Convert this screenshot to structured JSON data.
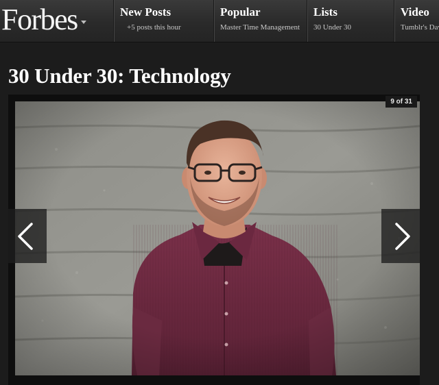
{
  "brand": {
    "logo_text": "Forbes",
    "logo_icon": "chevron-down-icon"
  },
  "nav": [
    {
      "title": "New Posts",
      "subtitle": "+5 posts this hour"
    },
    {
      "title": "Popular",
      "subtitle": "Master Time Management"
    },
    {
      "title": "Lists",
      "subtitle": "30 Under 30"
    },
    {
      "title": "Video",
      "subtitle": "Tumblr's David Karp"
    }
  ],
  "page": {
    "title": "30 Under 30: Technology"
  },
  "slideshow": {
    "counter": "9 of 31",
    "prev_icon": "chevron-left-icon",
    "next_icon": "chevron-right-icon",
    "photo": "portrait-photo"
  },
  "colors": {
    "background": "#1c1c1c",
    "topbar": "#2e2e2e",
    "shirt": "#6e2d41",
    "wall": "#8a8a84"
  }
}
